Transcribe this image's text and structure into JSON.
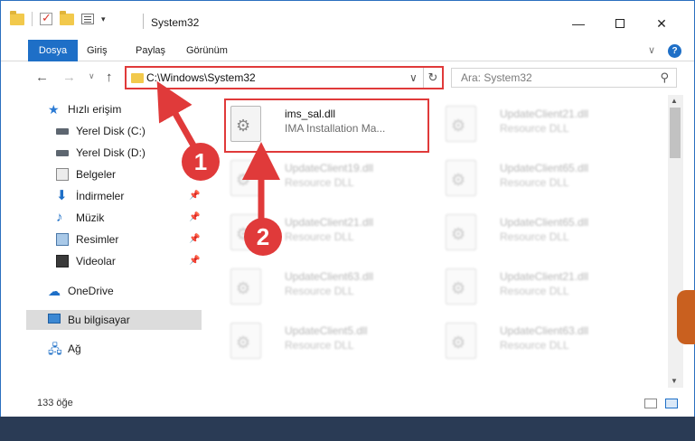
{
  "window": {
    "title": "System32",
    "minimize_label": "—",
    "close_label": "✕"
  },
  "ribbon": {
    "tabs": [
      "Dosya",
      "Giriş",
      "Paylaş",
      "Görünüm"
    ],
    "collapse_label": "∨",
    "help_label": "?"
  },
  "nav": {
    "back_label": "←",
    "forward_label": "→",
    "recent_label": "∨",
    "up_label": "↑",
    "address": "C:\\Windows\\System32",
    "address_dropdown": "∨",
    "refresh_label": "↻",
    "search_placeholder": "Ara: System32",
    "search_icon_label": "⚲"
  },
  "sidebar": {
    "items": [
      {
        "label": "Hızlı erişim",
        "icon": "star-icon",
        "pinned": false
      },
      {
        "label": "Yerel Disk (C:)",
        "icon": "disk-icon",
        "pinned": false
      },
      {
        "label": "Yerel Disk (D:)",
        "icon": "disk-icon",
        "pinned": false
      },
      {
        "label": "Belgeler",
        "icon": "documents-icon",
        "pinned": true
      },
      {
        "label": "İndirmeler",
        "icon": "download-icon",
        "pinned": true
      },
      {
        "label": "Müzik",
        "icon": "music-icon",
        "pinned": true
      },
      {
        "label": "Resimler",
        "icon": "pictures-icon",
        "pinned": true
      },
      {
        "label": "Videolar",
        "icon": "video-icon",
        "pinned": true
      },
      {
        "label": "OneDrive",
        "icon": "cloud-icon",
        "pinned": false
      },
      {
        "label": "Bu bilgisayar",
        "icon": "computer-icon",
        "pinned": false,
        "selected": true
      },
      {
        "label": "Ağ",
        "icon": "network-icon",
        "pinned": false
      }
    ],
    "pin_glyph": "📌"
  },
  "files": [
    {
      "name": "ims_sal.dll",
      "desc": "IMA Installation Ma...",
      "highlighted": true
    },
    {
      "name": "UpdateClient21.dll",
      "desc": "Resource DLL"
    },
    {
      "name": "UpdateClient19.dll",
      "desc": "Resource DLL"
    },
    {
      "name": "UpdateClient65.dll",
      "desc": "Resource DLL"
    },
    {
      "name": "UpdateClient21.dll",
      "desc": "Resource DLL"
    },
    {
      "name": "UpdateClient65.dll",
      "desc": "Resource DLL"
    },
    {
      "name": "UpdateClient63.dll",
      "desc": "Resource DLL"
    },
    {
      "name": "UpdateClient21.dll",
      "desc": "Resource DLL"
    },
    {
      "name": "UpdateClient5.dll",
      "desc": "Resource DLL"
    },
    {
      "name": "UpdateClient63.dll",
      "desc": "Resource DLL"
    }
  ],
  "status": {
    "count": "133 öğe"
  },
  "annotations": {
    "step1": "1",
    "step2": "2"
  },
  "colors": {
    "accent": "#1e6fc7",
    "annotation": "#e03a3a"
  }
}
